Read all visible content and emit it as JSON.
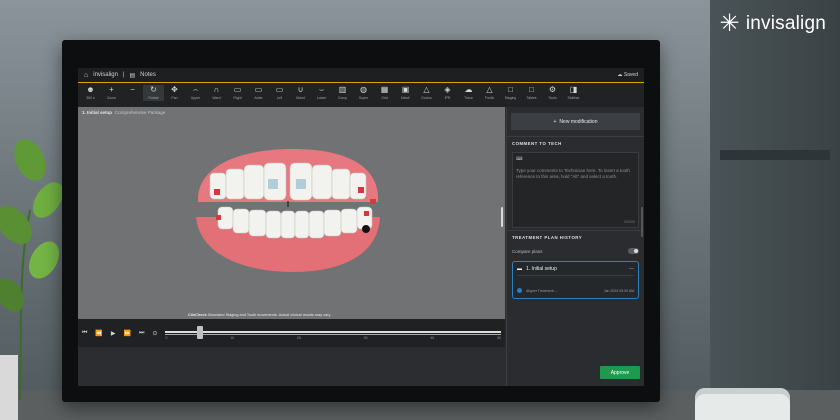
{
  "brand": {
    "name": "invisalign",
    "mark": "✳"
  },
  "app": {
    "logo_text": "invisalign",
    "tab_label": "Notes",
    "saved_label": "Saved"
  },
  "toolbar": [
    {
      "glyph": "☻",
      "label": "360 s"
    },
    {
      "glyph": "+",
      "label": "Zoom"
    },
    {
      "glyph": "−",
      "label": ""
    },
    {
      "glyph": "↻",
      "label": "Rotate"
    },
    {
      "glyph": "✥",
      "label": "Pan"
    },
    {
      "glyph": "⌢",
      "label": "Upper"
    },
    {
      "glyph": "∩",
      "label": "Ward"
    },
    {
      "glyph": "▭",
      "label": "Right"
    },
    {
      "glyph": "▭",
      "label": "Anter"
    },
    {
      "glyph": "▭",
      "label": "Left"
    },
    {
      "glyph": "∪",
      "label": "Mand"
    },
    {
      "glyph": "⌣",
      "label": "Lower"
    },
    {
      "glyph": "▥",
      "label": "Comp"
    },
    {
      "glyph": "◍",
      "label": "Super"
    },
    {
      "glyph": "▦",
      "label": "Grid"
    },
    {
      "glyph": "▣",
      "label": "Attach"
    },
    {
      "glyph": "△",
      "label": "Occlus"
    },
    {
      "glyph": "◈",
      "label": "IPR"
    },
    {
      "glyph": "☁",
      "label": "Trace"
    },
    {
      "glyph": "△",
      "label": "Pontic"
    },
    {
      "glyph": "□",
      "label": "Staging"
    },
    {
      "glyph": "□",
      "label": "Tables"
    },
    {
      "glyph": "⚙",
      "label": "Tools"
    },
    {
      "glyph": "◨",
      "label": "Sidebar"
    }
  ],
  "viewport": {
    "caption_title": "1. Initial setup",
    "caption_sub": "Comprehensive Package",
    "disclaimer_title": "ClinCheck",
    "disclaimer_text": "Simulated Staging and Tooth movements. Actual clinical results may vary."
  },
  "timeline": {
    "ticks": [
      "0",
      "10",
      "20",
      "30",
      "40",
      "50"
    ],
    "buttons": [
      "⏮",
      "⏪",
      "▶",
      "⏩",
      "⏭",
      "⊙"
    ]
  },
  "right_panel": {
    "new_modification": "New modification",
    "comment_title": "Comment to Tech",
    "comment_placeholder": "Type your comments to Technician here. To insert a tooth reference to this area, hold \"Alt\" and select a tooth.",
    "comment_counter": "0/2000",
    "history_title": "Treatment Plan History",
    "compare_label": "Compare plans",
    "setup_label": "1. Initial setup",
    "setup_sub": "Aligner Treatment ...",
    "setup_meta": "Jan 2024 09:00 AM",
    "approve_label": "Approve"
  },
  "colors": {
    "accent": "#e2a100",
    "approve": "#1d9a4e",
    "selected": "#2e7fc1"
  }
}
